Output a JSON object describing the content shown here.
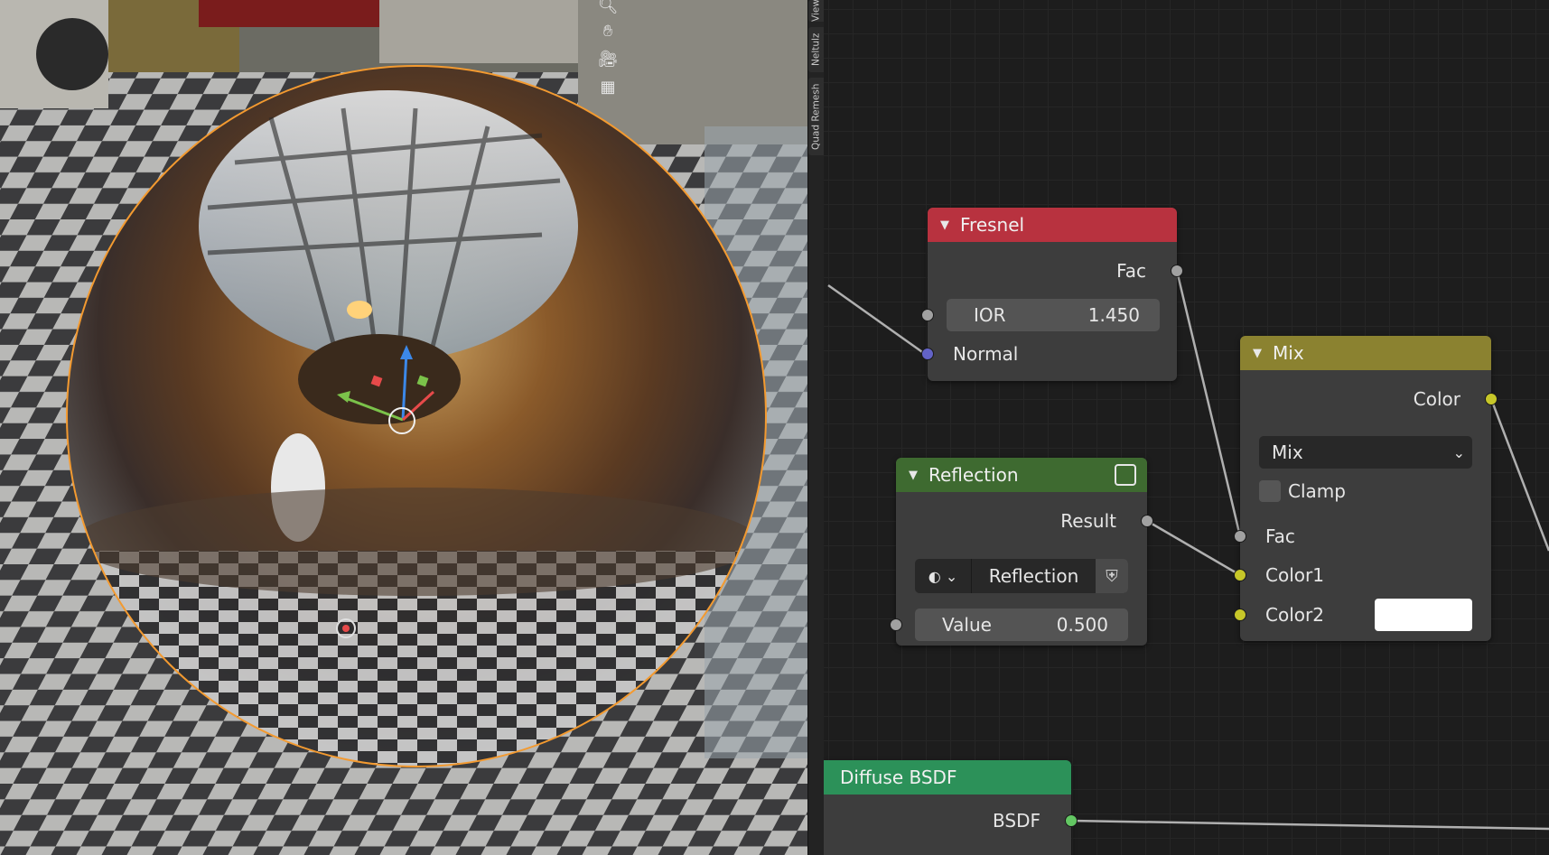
{
  "viewport": {
    "tabs": [
      "View",
      "Neltulz",
      "Quad Remesh"
    ],
    "tools": [
      "zoom-icon",
      "hand-pan-icon",
      "camera-icon",
      "grid-perspective-icon"
    ]
  },
  "nodes": {
    "fresnel": {
      "title": "Fresnel",
      "output_fac": "Fac",
      "ior_label": "IOR",
      "ior_value": "1.450",
      "normal_label": "Normal",
      "header_color": "#b8323f"
    },
    "reflection": {
      "title": "Reflection",
      "output_result": "Result",
      "source_value": "Reflection",
      "value_label": "Value",
      "value_value": "0.500",
      "header_color": "#3e6a30"
    },
    "mix": {
      "title": "Mix",
      "output_color": "Color",
      "blend_mode": "Mix",
      "clamp_label": "Clamp",
      "fac_label": "Fac",
      "color1_label": "Color1",
      "color2_label": "Color2",
      "color2_value": "#ffffff",
      "header_color": "#8b8230"
    },
    "diffuse": {
      "title": "Diffuse BSDF",
      "output_bsdf": "BSDF",
      "header_color": "#2c9159"
    }
  },
  "socket_colors": {
    "float": "#a1a1a1",
    "vector": "#6363c7",
    "color": "#c7c729",
    "shader": "#63c763"
  }
}
